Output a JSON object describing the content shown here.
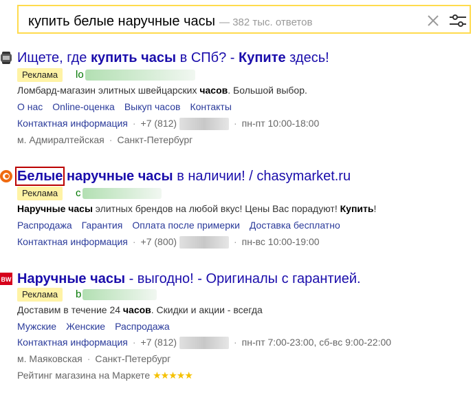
{
  "search": {
    "query": "купить белые наручные часы",
    "count": "— 382 тыс. ответов"
  },
  "ads": [
    {
      "title_parts": [
        {
          "t": "Ищете, где ",
          "b": false
        },
        {
          "t": "купить часы",
          "b": true
        },
        {
          "t": " в СПб? - ",
          "b": false
        },
        {
          "t": "Купите",
          "b": true
        },
        {
          "t": " здесь!",
          "b": false
        }
      ],
      "badge": "Реклама",
      "url_start": "lo",
      "desc_parts": [
        {
          "t": "Ломбард-магазин элитных швейцарских ",
          "b": false
        },
        {
          "t": "часов",
          "b": true
        },
        {
          "t": ". Большой выбор.",
          "b": false
        }
      ],
      "links": [
        "О нас",
        "Online-оценка",
        "Выкуп часов",
        "Контакты"
      ],
      "contact": "Контактная информация",
      "phone": "+7 (812)",
      "hours": "пн-пт 10:00-18:00",
      "address": [
        "м. Адмиралтейская",
        "Санкт-Петербург"
      ]
    },
    {
      "title_parts": [
        {
          "t": "Белые",
          "b": true,
          "hl": true
        },
        {
          "t": " ",
          "b": false
        },
        {
          "t": "наручные часы",
          "b": true
        },
        {
          "t": " в наличии! / chasymarket.ru",
          "b": false
        }
      ],
      "badge": "Реклама",
      "url_start": "c",
      "desc_parts": [
        {
          "t": "Наручные часы",
          "b": true
        },
        {
          "t": " элитных брендов на любой вкус! Цены Вас порадуют! ",
          "b": false
        },
        {
          "t": "Купить",
          "b": true
        },
        {
          "t": "!",
          "b": false
        }
      ],
      "links": [
        "Распродажа",
        "Гарантия",
        "Оплата после примерки",
        "Доставка бесплатно"
      ],
      "contact": "Контактная информация",
      "phone": "+7 (800)",
      "hours": "пн-вс 10:00-19:00"
    },
    {
      "title_parts": [
        {
          "t": "Наручные часы",
          "b": true
        },
        {
          "t": " - выгодно! - Оригиналы с гарантией.",
          "b": false
        }
      ],
      "badge": "Реклама",
      "url_start": "b",
      "desc_parts": [
        {
          "t": "Доставим в течение 24 ",
          "b": false
        },
        {
          "t": "часов",
          "b": true
        },
        {
          "t": ". Скидки и акции - всегда",
          "b": false
        }
      ],
      "links": [
        "Мужские",
        "Женские",
        "Распродажа"
      ],
      "contact": "Контактная информация",
      "phone": "+7 (812)",
      "hours": "пн-пт 7:00-23:00, сб-вс 9:00-22:00",
      "address": [
        "м. Маяковская",
        "Санкт-Петербург"
      ],
      "rating_label": "Рейтинг магазина на Маркете",
      "rating_stars": "★★★★★",
      "rating_value": 5
    }
  ]
}
